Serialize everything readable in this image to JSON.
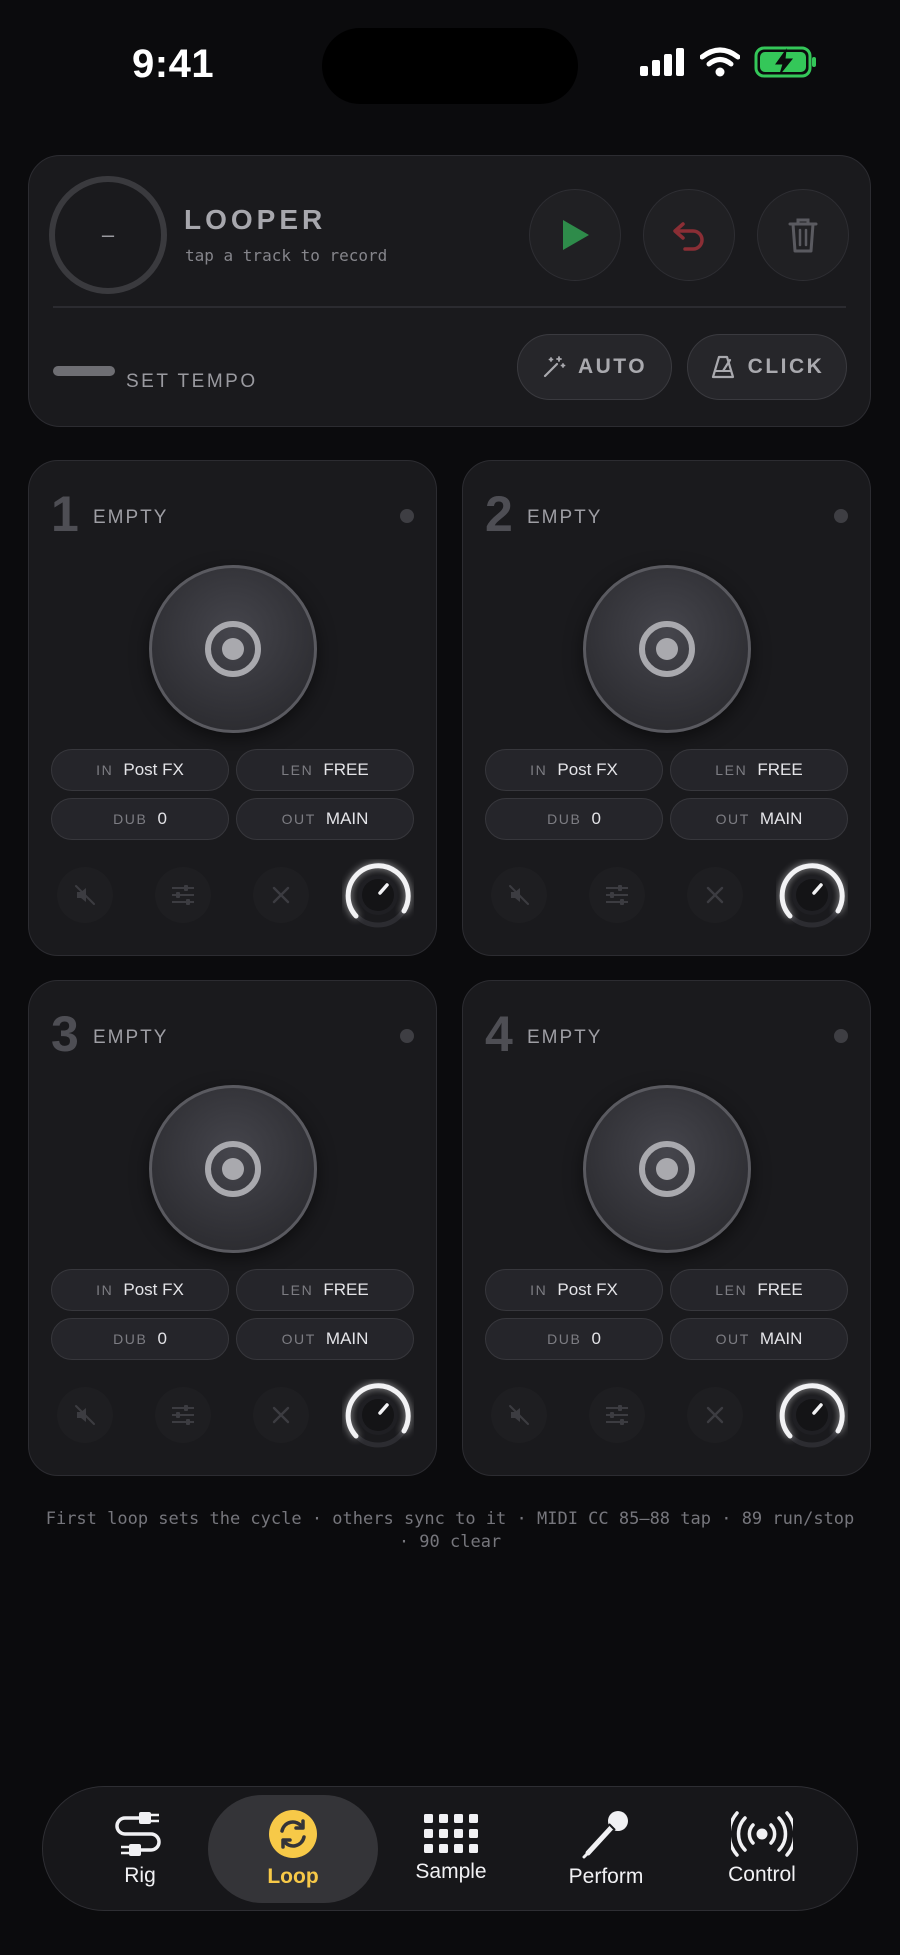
{
  "status": {
    "time": "9:41"
  },
  "looper": {
    "ring_value": "–",
    "title": "LOOPER",
    "subtitle": "tap a track to record",
    "tempo_label": "SET TEMPO",
    "auto_label": "AUTO",
    "click_label": "CLICK"
  },
  "tracks": [
    {
      "number": "1",
      "state": "EMPTY",
      "in_key": "IN",
      "in_val": "Post FX",
      "len_key": "LEN",
      "len_val": "FREE",
      "dub_key": "DUB",
      "dub_val": "0",
      "out_key": "OUT",
      "out_val": "MAIN"
    },
    {
      "number": "2",
      "state": "EMPTY",
      "in_key": "IN",
      "in_val": "Post FX",
      "len_key": "LEN",
      "len_val": "FREE",
      "dub_key": "DUB",
      "dub_val": "0",
      "out_key": "OUT",
      "out_val": "MAIN"
    },
    {
      "number": "3",
      "state": "EMPTY",
      "in_key": "IN",
      "in_val": "Post FX",
      "len_key": "LEN",
      "len_val": "FREE",
      "dub_key": "DUB",
      "dub_val": "0",
      "out_key": "OUT",
      "out_val": "MAIN"
    },
    {
      "number": "4",
      "state": "EMPTY",
      "in_key": "IN",
      "in_val": "Post FX",
      "len_key": "LEN",
      "len_val": "FREE",
      "dub_key": "DUB",
      "dub_val": "0",
      "out_key": "OUT",
      "out_val": "MAIN"
    }
  ],
  "hint": "First loop sets the cycle · others sync to it · MIDI CC 85–88 tap · 89 run/stop · 90 clear",
  "tabs": [
    {
      "label": "Rig",
      "icon": "cable-icon"
    },
    {
      "label": "Loop",
      "icon": "loop-icon"
    },
    {
      "label": "Sample",
      "icon": "grid-pads-icon"
    },
    {
      "label": "Perform",
      "icon": "microphone-icon"
    },
    {
      "label": "Control",
      "icon": "broadcast-icon"
    }
  ],
  "colors": {
    "accent": "#f7c948",
    "play": "#2e8b4a",
    "undo": "#8b2e35",
    "battery": "#34c759"
  }
}
